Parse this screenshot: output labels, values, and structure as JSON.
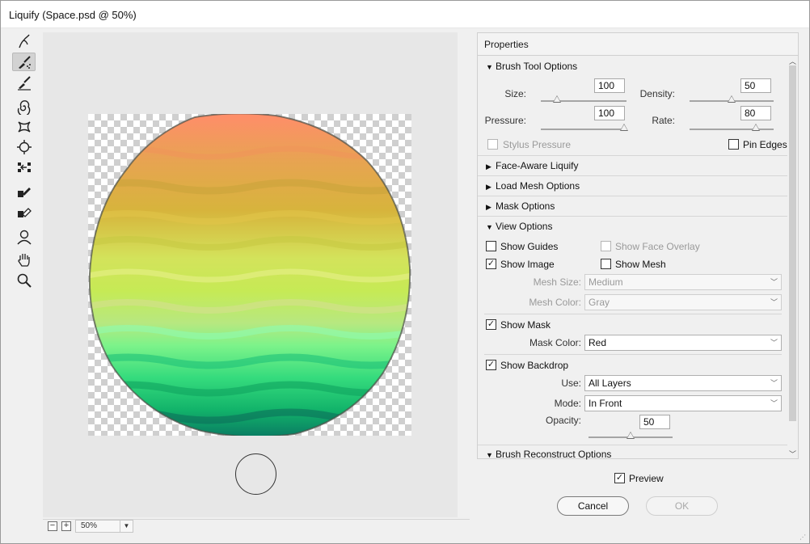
{
  "window": {
    "title": "Liquify (Space.psd @ 50%)"
  },
  "tools": [
    {
      "icon": "forward-warp-icon",
      "active": false
    },
    {
      "icon": "reconstruct-brush-icon",
      "active": true
    },
    {
      "icon": "smooth-icon",
      "active": false
    },
    {
      "icon": "twirl-icon",
      "active": false
    },
    {
      "icon": "pucker-icon",
      "active": false
    },
    {
      "icon": "bloat-icon",
      "active": false
    },
    {
      "icon": "push-left-icon",
      "active": false
    },
    {
      "icon": "freeze-mask-icon",
      "active": false
    },
    {
      "icon": "thaw-mask-icon",
      "active": false
    },
    {
      "icon": "face-tool-icon",
      "active": false
    },
    {
      "icon": "hand-icon",
      "active": false
    },
    {
      "icon": "zoom-icon",
      "active": false
    }
  ],
  "zoom": {
    "minus": "−",
    "plus": "+",
    "value": "50%"
  },
  "properties": {
    "title": "Properties",
    "brush_tool_options": {
      "header": "Brush Tool Options",
      "size_label": "Size:",
      "size": "100",
      "density_label": "Density:",
      "density": "50",
      "pressure_label": "Pressure:",
      "pressure": "100",
      "rate_label": "Rate:",
      "rate": "80",
      "stylus_pressure": "Stylus Pressure",
      "pin_edges": "Pin Edges"
    },
    "face_aware": "Face-Aware Liquify",
    "load_mesh": "Load Mesh Options",
    "mask_options": "Mask Options",
    "view_options": {
      "header": "View Options",
      "show_guides": "Show Guides",
      "show_face_overlay": "Show Face Overlay",
      "show_image": "Show Image",
      "show_mesh": "Show Mesh",
      "mesh_size_label": "Mesh Size:",
      "mesh_size": "Medium",
      "mesh_color_label": "Mesh Color:",
      "mesh_color": "Gray",
      "show_mask": "Show Mask",
      "mask_color_label": "Mask Color:",
      "mask_color": "Red",
      "show_backdrop": "Show Backdrop",
      "use_label": "Use:",
      "use": "All Layers",
      "mode_label": "Mode:",
      "mode": "In Front",
      "opacity_label": "Opacity:",
      "opacity": "50"
    },
    "brush_reconstruct": "Brush Reconstruct Options"
  },
  "footer": {
    "preview": "Preview",
    "cancel": "Cancel",
    "ok": "OK"
  },
  "checkmark": "✓",
  "colors": {
    "accent": "#6b6b6b",
    "canvas": "#e7e7e7"
  }
}
